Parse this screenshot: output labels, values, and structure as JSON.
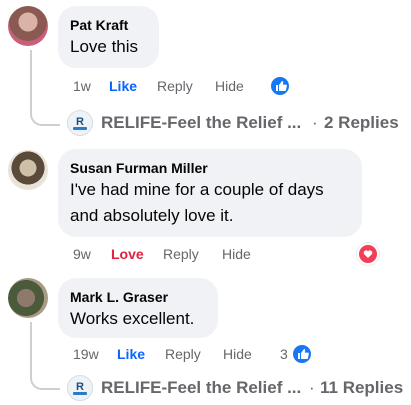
{
  "comments": [
    {
      "author": "Pat Kraft",
      "text": "Love this",
      "time": "1w",
      "reaction_label": "Like",
      "reply_label": "Reply",
      "hide_label": "Hide",
      "reactions_icon": "like-icon",
      "replies": {
        "page_name": "RELIFE-Feel the Relief ...",
        "count_text": "2 Replies"
      }
    },
    {
      "author": "Susan Furman Miller",
      "text": "I've had mine for a couple of days and absolutely love it.",
      "time": "9w",
      "reaction_label": "Love",
      "reply_label": "Reply",
      "hide_label": "Hide",
      "reactions_icon": "love-icon"
    },
    {
      "author": "Mark L. Graser",
      "text": "Works excellent.",
      "time": "19w",
      "reaction_label": "Like",
      "reply_label": "Reply",
      "hide_label": "Hide",
      "reactions_icon": "like-icon",
      "reaction_count": "3",
      "replies": {
        "page_name": "RELIFE-Feel the Relief ...",
        "count_text": "11 Replies"
      }
    }
  ],
  "colors": {
    "like": "#0866ff",
    "love": "#e41e3f",
    "bubble": "#f0f2f5",
    "muted": "#65676b"
  }
}
